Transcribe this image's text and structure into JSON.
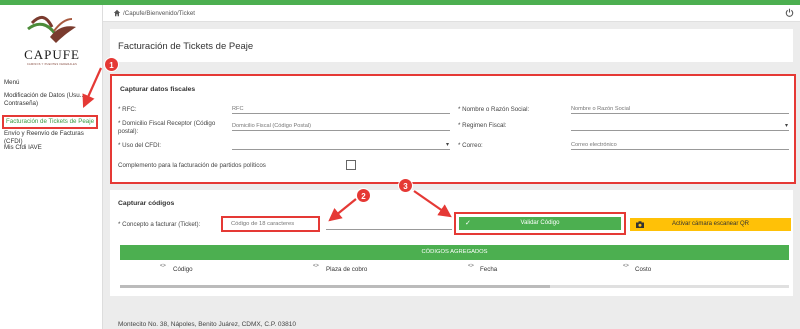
{
  "app": {
    "accent_color": "#4caf50",
    "annotation_color": "#e53935",
    "logo": {
      "name": "CAPUFE",
      "subtitle": "CAMINOS Y PUENTES FEDERALES"
    }
  },
  "sidebar": {
    "items": [
      {
        "label": "Menú"
      },
      {
        "label": "Modificación de Datos (Usu... Contraseña)"
      },
      {
        "label": "Facturación de Tickets de Peaje",
        "active": true
      },
      {
        "label": "Envío y Reenvío de Facturas (CFDI)"
      },
      {
        "label": "Mis Cfdi IAVE"
      }
    ]
  },
  "header": {
    "breadcrumb": "/Capufe/Bienvenido/Ticket",
    "icons": [
      "home-icon",
      "power-icon"
    ]
  },
  "page": {
    "title": "Facturación de Tickets de Peaje"
  },
  "fiscal": {
    "title": "Capturar datos fiscales",
    "rfc_label": "* RFC:",
    "rfc_placeholder": "RFC",
    "nombre_label": "* Nombre o Razón Social:",
    "nombre_placeholder": "Nombre o Razón Social",
    "domicilio_label": "* Domicilio Fiscal Receptor (Código postal):",
    "domicilio_placeholder": "Domicilio Fiscal (Código Postal)",
    "regimen_label": "* Regimen Fiscal:",
    "uso_label": "* Uso del CFDI:",
    "correo_label": "* Correo:",
    "correo_placeholder": "Correo electrónico",
    "complemento_label": "Complemento para la facturación de partidos políticos",
    "complemento_checked": false
  },
  "codes": {
    "title": "Capturar códigos",
    "concepto_label": "* Concepto a facturar (Ticket):",
    "code_placeholder": "Código de 18 caracteres",
    "validate_label": "Validar Código",
    "qr_label": "Activar cámara escanear QR",
    "table_title": "CÓDIGOS AGREGADOS",
    "columns": [
      "Código",
      "Plaza de cobro",
      "Fecha",
      "Costo"
    ]
  },
  "footer": {
    "address": "Montecito No. 38, Nápoles, Benito Juárez, CDMX, C.P. 03810"
  },
  "annotations": [
    {
      "number": "1"
    },
    {
      "number": "2"
    },
    {
      "number": "3"
    }
  ]
}
